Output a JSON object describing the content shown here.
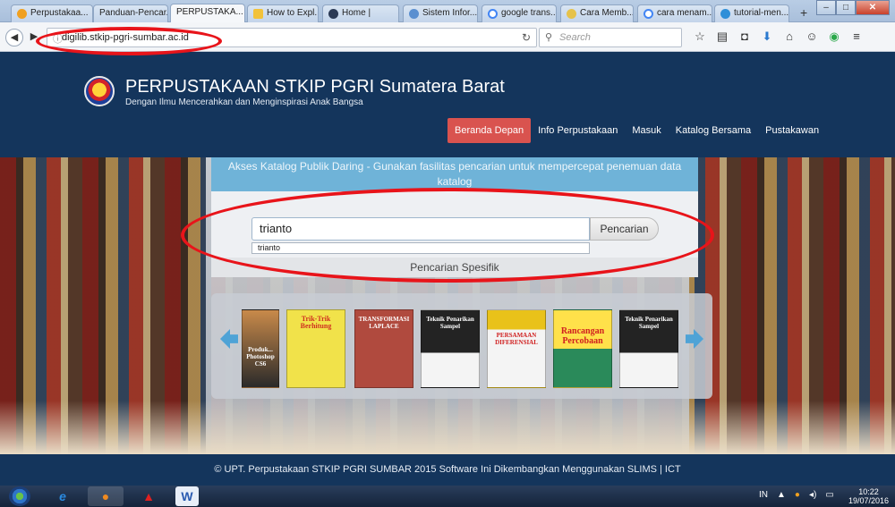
{
  "browser": {
    "tabs": [
      {
        "label": "Perpustakaa..."
      },
      {
        "label": "Panduan-Pencar..."
      },
      {
        "label": "PERPUSTAKA..."
      },
      {
        "label": "How to Expl..."
      },
      {
        "label": "Home |"
      },
      {
        "label": "Sistem Infor..."
      },
      {
        "label": "google trans..."
      },
      {
        "label": "Cara Memb..."
      },
      {
        "label": "cara menam..."
      },
      {
        "label": "tutorial-men..."
      }
    ],
    "new_tab": "+",
    "url_prefix": "ⓘ",
    "url": "digilib.stkip-pgri-sumbar.ac.id",
    "search_placeholder": "Search"
  },
  "site": {
    "title": "PERPUSTAKAAN STKIP PGRI Sumatera Barat",
    "tagline": "Dengan Ilmu Mencerahkan dan Menginspirasi Anak Bangsa",
    "menu": [
      {
        "label": "Beranda Depan"
      },
      {
        "label": "Info Perpustakaan"
      },
      {
        "label": "Masuk"
      },
      {
        "label": "Katalog Bersama"
      },
      {
        "label": "Pustakawan"
      }
    ]
  },
  "search": {
    "heading": "Akses Katalog Publik Daring - Gunakan fasilitas pencarian untuk mempercepat penemuan data katalog",
    "query": "trianto",
    "button": "Pencarian",
    "suggestion": "trianto",
    "specific_link": "Pencarian Spesifik"
  },
  "carousel": {
    "books": [
      {
        "title": "Produk... Photoshop CS6",
        "subtitle": ""
      },
      {
        "title": "Trik-Trik Berhitung",
        "subtitle": ""
      },
      {
        "title": "TRANSFORMASI LAPLACE",
        "subtitle": ""
      },
      {
        "title": "Teknik Penarikan Sampel",
        "subtitle": ""
      },
      {
        "title": "PERSAMAAN DIFERENSIAL",
        "subtitle": ""
      },
      {
        "title": "Rancangan Percobaan",
        "subtitle": ""
      },
      {
        "title": "Teknik Penarikan Sampel",
        "subtitle": ""
      }
    ]
  },
  "footer": {
    "text": "© UPT. Perpustakaan STKIP PGRI SUMBAR 2015 Software Ini Dikembangkan Menggunakan SLIMS | ICT"
  },
  "taskbar": {
    "language": "IN",
    "time": "10:22",
    "date": "19/07/2016"
  },
  "colors": {
    "header_bg": "#14355c",
    "menu_active": "#d9534f",
    "panel_head": "#6fb3d8",
    "annotation": "#e8141a"
  }
}
